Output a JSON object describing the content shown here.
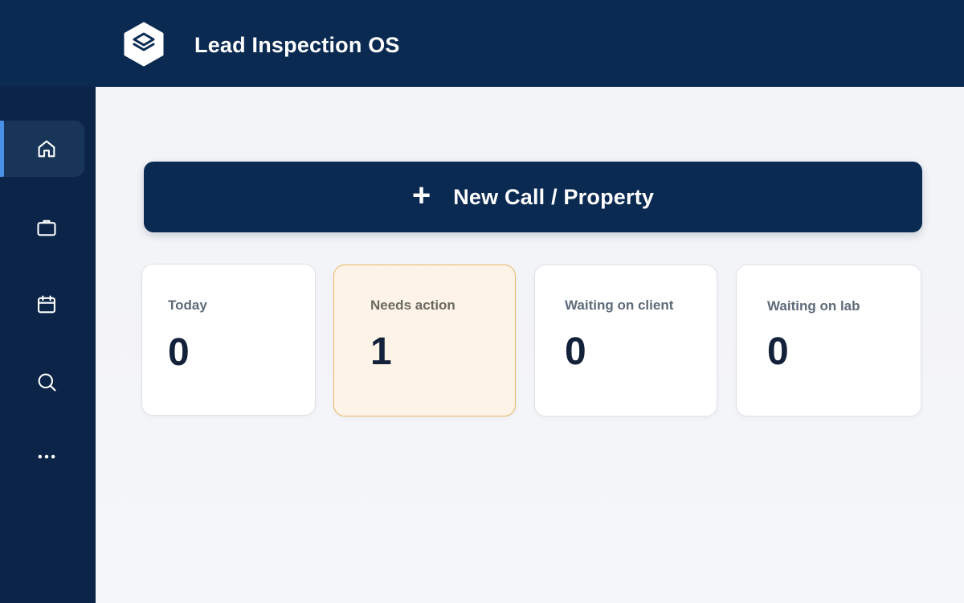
{
  "app": {
    "title": "Lead Inspection OS",
    "logo_icon": "layers-icon"
  },
  "sidebar": {
    "items": [
      {
        "id": "home",
        "icon": "home-icon",
        "active": true
      },
      {
        "id": "jobs",
        "icon": "briefcase-icon",
        "active": false
      },
      {
        "id": "calendar",
        "icon": "calendar-icon",
        "active": false
      },
      {
        "id": "search",
        "icon": "search-icon",
        "active": false
      },
      {
        "id": "more",
        "icon": "more-horizontal-icon",
        "active": false
      }
    ]
  },
  "actions": {
    "new_call_icon": "plus-icon",
    "new_call_label": "New Call / Property"
  },
  "stats": [
    {
      "title": "Today",
      "count": "0",
      "highlight": false
    },
    {
      "title": "Needs action",
      "count": "1",
      "highlight": true
    },
    {
      "title": "Waiting on client",
      "count": "0",
      "highlight": false
    },
    {
      "title": "Waiting on lab",
      "count": "0",
      "highlight": false
    }
  ],
  "colors": {
    "sidebar_bg": "#0b2447",
    "header_bg": "#0b2a52",
    "accent": "#4a8fe8",
    "highlight_bg": "#fdf3e6",
    "highlight_border": "#e9b868"
  }
}
